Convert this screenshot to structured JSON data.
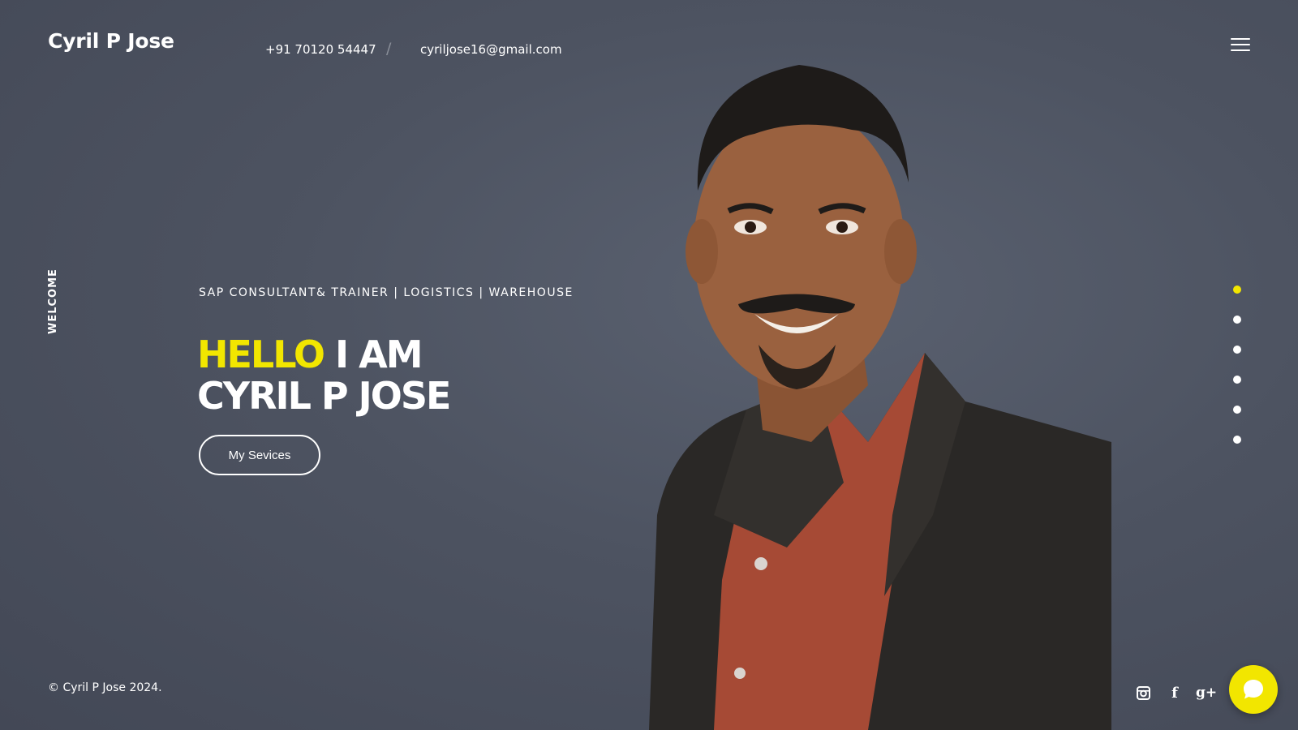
{
  "header": {
    "brand": "Cyril P Jose",
    "phone": "+91 70120 54447",
    "separator": "/",
    "email": "cyriljose16@gmail.com",
    "menu_icon": "hamburger-icon"
  },
  "side": {
    "label": "WELCOME"
  },
  "hero": {
    "tagline": "SAP CONSULTANT& TRAINER | LOGISTICS | WAREHOUSE",
    "headline_highlight": "HELLO",
    "headline_rest": " I AM",
    "headline_line2": "CYRIL P JOSE",
    "button_label": "My Sevices"
  },
  "slides": {
    "count": 6,
    "active_index": 0
  },
  "footer": {
    "copyright": "© Cyril P Jose 2024.",
    "social": [
      "instagram-icon",
      "facebook-icon",
      "google-plus-icon"
    ],
    "facebook_glyph": "f",
    "google_plus_glyph": "g+"
  },
  "colors": {
    "accent": "#f2e600",
    "background": "#4d5361"
  }
}
